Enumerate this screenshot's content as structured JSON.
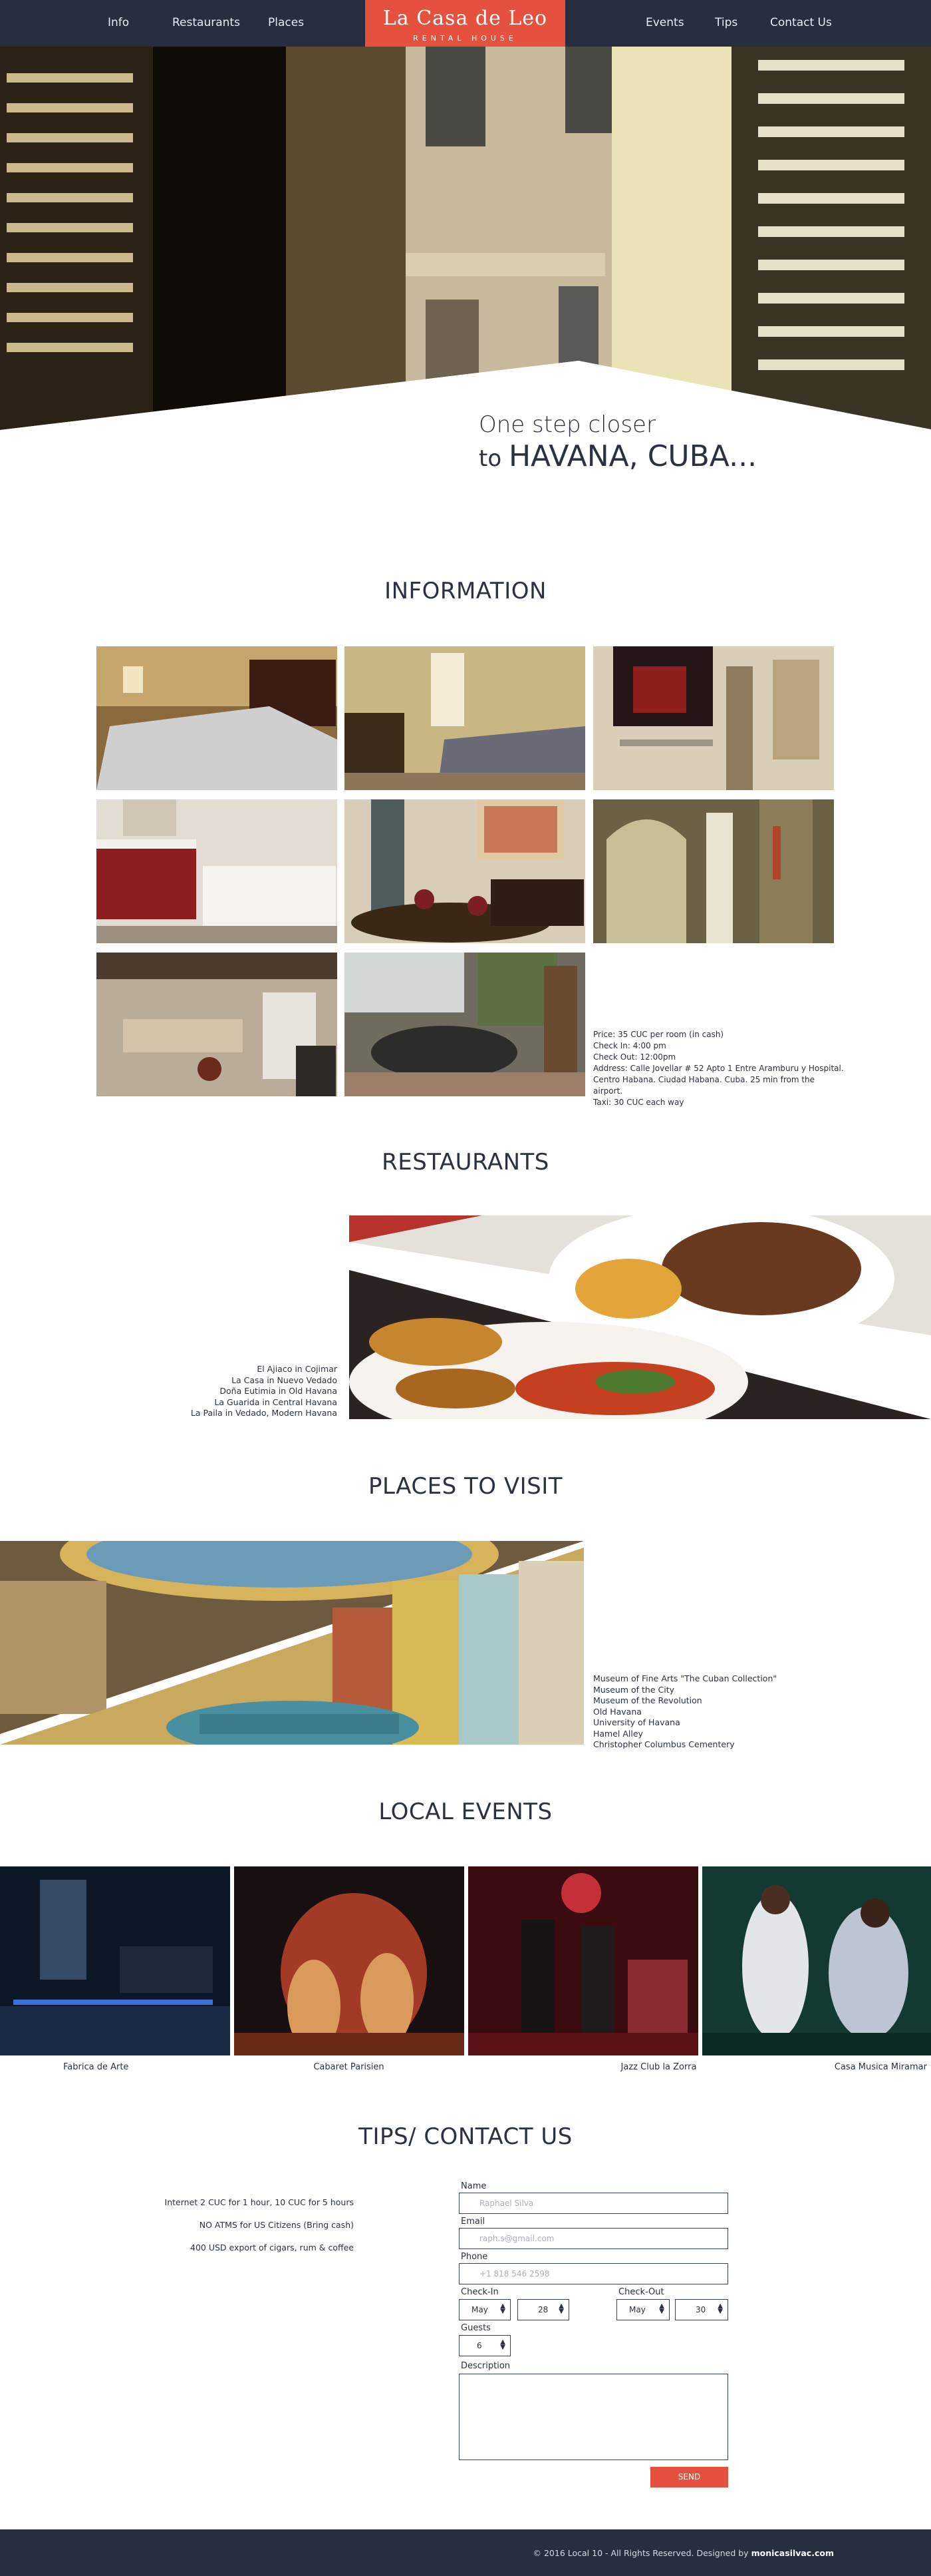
{
  "nav": {
    "left": [
      "Info",
      "Restaurants",
      "Places"
    ],
    "right": [
      "Events",
      "Tips",
      "Contact Us"
    ],
    "logo_main": "La Casa de Leo",
    "logo_sub": "RENTAL HOUSE"
  },
  "hero": {
    "line1": "One step closer",
    "line2_prefix": "to",
    "line2_emph": "HAVANA, CUBA..."
  },
  "info": {
    "title": "INFORMATION",
    "details": [
      "Price: 35 CUC per room (in cash)",
      "Check In: 4:00 pm",
      "Check Out: 12:00pm",
      "Address: Calle Jovellar # 52 Apto 1 Entre Aramburu y Hospital.",
      "Centro Habana. Ciudad Habana. Cuba. 25 min from the airport.",
      "Taxi: 30 CUC each way"
    ]
  },
  "restaurants": {
    "title": "RESTAURANTS",
    "items": [
      "El Ajiaco in Cojimar",
      "La Casa in Nuevo Vedado",
      "Doña Eutimia in Old Havana",
      "La Guarida in Central Havana",
      "La Paila in Vedado, Modern Havana"
    ]
  },
  "places": {
    "title": "PLACES TO VISIT",
    "items": [
      "Museum of Fine Arts \"The Cuban Collection\"",
      "Museum of the City",
      "Museum of the Revolution",
      "Old Havana",
      "University of Havana",
      "Hamel Alley",
      "Christopher Columbus Cementery"
    ]
  },
  "events": {
    "title": "LOCAL EVENTS",
    "items": [
      "Fabrica de Arte",
      "Cabaret Parisien",
      "Jazz Club la Zorra",
      "Casa Musica Miramar"
    ]
  },
  "contact": {
    "title": "TIPS/ CONTACT US",
    "tips": [
      "Internet 2 CUC for 1 hour, 10 CUC for 5 hours",
      "NO ATMS for US Citizens (Bring cash)",
      "400 USD export of cigars, rum & coffee"
    ],
    "name_label": "Name",
    "name_placeholder": "Raphael Silva",
    "email_label": "Email",
    "email_placeholder": "raph.s@gmail.com",
    "phone_label": "Phone",
    "phone_placeholder": "+1 818 546 2598",
    "checkin_label": "Check-In",
    "checkin_month": "May",
    "checkin_day": "28",
    "checkout_label": "Check-Out",
    "checkout_month": "May",
    "checkout_day": "30",
    "guests_label": "Guests",
    "guests_value": "6",
    "description_label": "Description",
    "send_label": "SEND"
  },
  "footer": {
    "copyright": "© 2016 Local 10 - All Rights Reserved. Designed by",
    "designer": "monicasilvac.com"
  },
  "colors": {
    "navy": "#262e3f",
    "accent": "#e6503f"
  }
}
